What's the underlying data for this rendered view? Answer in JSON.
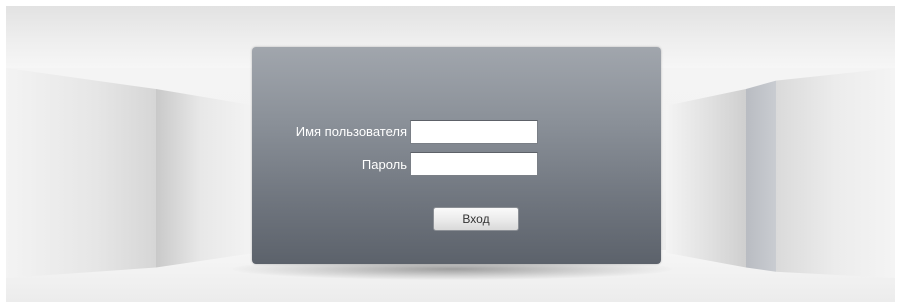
{
  "login": {
    "username_label": "Имя пользователя",
    "username_value": "",
    "password_label": "Пароль",
    "password_value": "",
    "submit_label": "Вход"
  },
  "colors": {
    "panel_top": "#a1a6ad",
    "panel_bottom": "#5c626b",
    "label_text": "#ffffff",
    "page_background": "#f2f2f2"
  }
}
